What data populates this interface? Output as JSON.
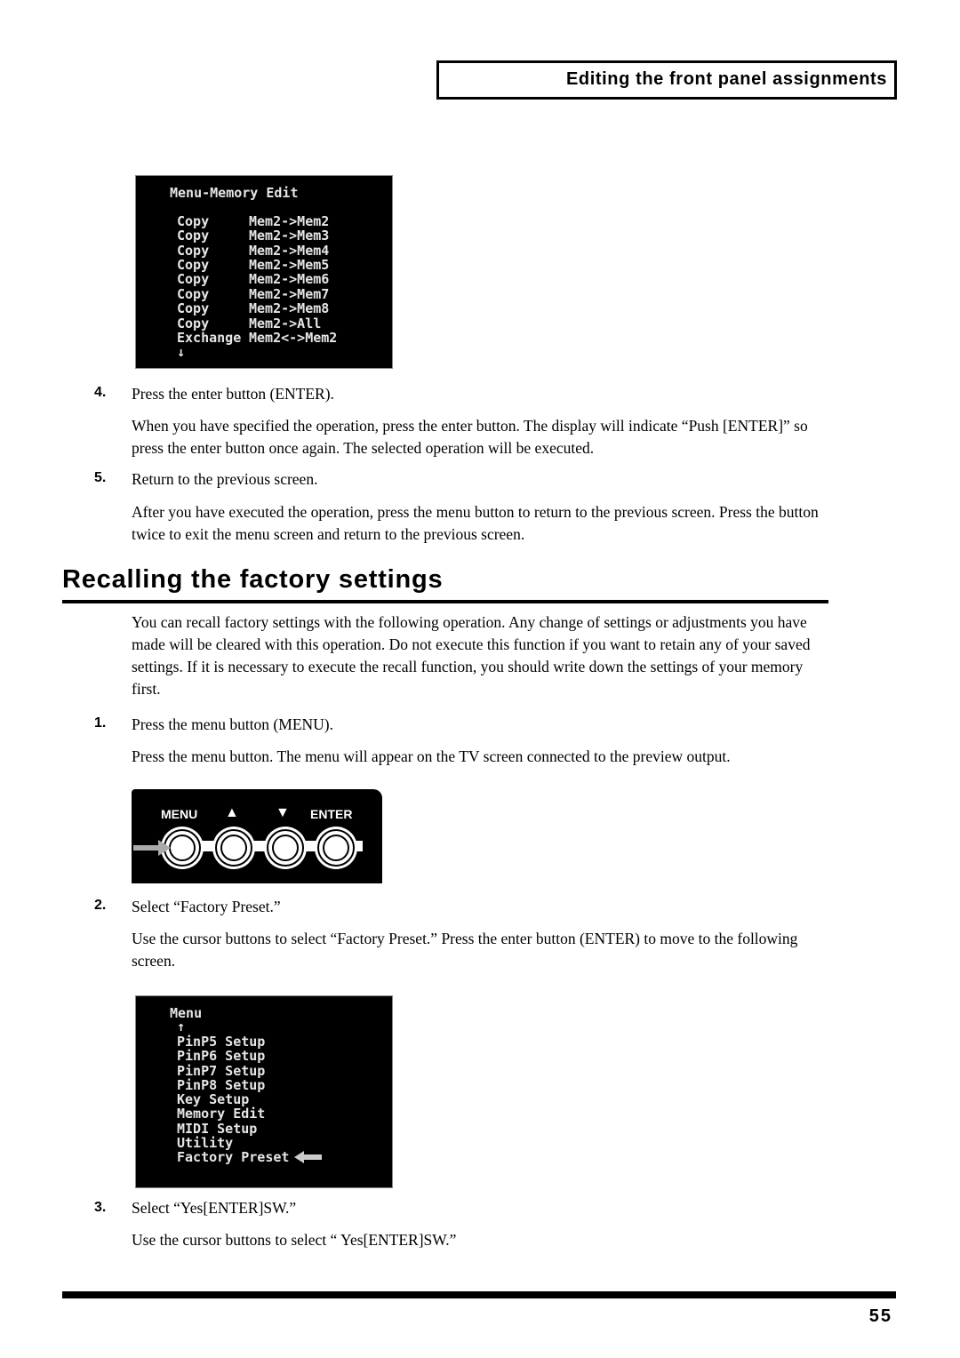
{
  "header": {
    "section_title": "Editing the front panel assignments"
  },
  "screen1": {
    "title": "Menu-Memory Edit",
    "rows": [
      {
        "op": "Copy",
        "target": "Mem2->Mem2"
      },
      {
        "op": "Copy",
        "target": "Mem2->Mem3"
      },
      {
        "op": "Copy",
        "target": "Mem2->Mem4"
      },
      {
        "op": "Copy",
        "target": "Mem2->Mem5"
      },
      {
        "op": "Copy",
        "target": "Mem2->Mem6"
      },
      {
        "op": "Copy",
        "target": "Mem2->Mem7"
      },
      {
        "op": "Copy",
        "target": "Mem2->Mem8"
      },
      {
        "op": "Copy",
        "target": "Mem2->All"
      },
      {
        "op": "Exchange",
        "target": "Mem2<->Mem2"
      }
    ],
    "scroll_glyph": "↓"
  },
  "steps_a": [
    {
      "num": "4.",
      "title": "Press the enter button (ENTER).",
      "body": "When you have specified the operation, press the enter button. The display will indicate “Push [ENTER]” so press the enter button once again. The selected operation will be executed."
    },
    {
      "num": "5.",
      "title": "Return to the previous screen.",
      "body": "After you have executed the operation, press the menu button to return to the previous screen. Press the button twice to exit the menu screen and return to the previous screen."
    }
  ],
  "section": {
    "heading": "Recalling the factory settings",
    "intro": "You can recall factory settings with the following operation. Any change of settings or adjustments you have made will be cleared with this operation. Do not execute this function if you want to retain any of your saved settings. If it is necessary to execute the recall function, you should write down the settings of your memory first."
  },
  "steps_b": [
    {
      "num": "1.",
      "title": "Press the menu button (MENU).",
      "body": "Press the menu button. The menu will appear on the TV screen connected to the preview output."
    },
    {
      "num": "2.",
      "title": "Select “Factory Preset.”",
      "body": "Use the cursor buttons to select “Factory Preset.” Press the enter button (ENTER) to move to the following screen."
    },
    {
      "num": "3.",
      "title": "Select “Yes[ENTER]SW.”",
      "body": "Use the cursor buttons to select “ Yes[ENTER]SW.”"
    }
  ],
  "panel": {
    "labels": [
      "MENU",
      "▲",
      "▼",
      "ENTER"
    ]
  },
  "screen2": {
    "title": "Menu",
    "scroll_glyph": "↑",
    "items": [
      "PinP5 Setup",
      "PinP6 Setup",
      "PinP7 Setup",
      "PinP8 Setup",
      "Key Setup",
      "Memory Edit",
      "MIDI Setup",
      "Utility",
      "Factory Preset"
    ],
    "selected_index": 8
  },
  "footer": {
    "page_number": "55"
  }
}
